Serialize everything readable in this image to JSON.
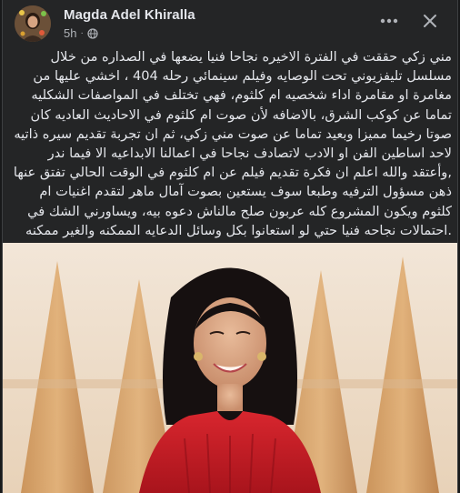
{
  "post": {
    "author_name": "Magda Adel Khiralla",
    "timestamp": "5h",
    "privacy_icon": "globe-icon",
    "more_icon": "more-horizontal-icon",
    "close_icon": "close-icon",
    "text_lines": [
      "مني زكي حققت في الفترة الاخيره نجاحا فنيا يضعها في الصداره من خلال",
      "مسلسل تليفزيوني تحت الوصايه وفيلم سينمائي رحله 404 ، اخشي عليها من",
      "مغامرة او مقامرة اداء شخصيه ام كلثوم، فهي تختلف  في المواصفات الشكليه",
      "تماما عن كوكب الشرق، بالاضافه لأن صوت ام كلثوم في الاحاديث العاديه كان",
      "صوتا رخيما مميزا وبعيد تماما عن صوت مني زكي، ثم ان تجربة تقديم سيره ذاتيه",
      "لاحد اساطين الفن او الادب لاتصادف نجاحا في اعمالنا  الابداعيه الا فيما ندر",
      ",وأعتقد والله اعلم ان فكرة تقديم فيلم عن ام كلثوم في الوقت الحالي تفتق عنها",
      "ذهن مسؤول الترفيه وطبعا سوف يستعين بصوت آمال ماهر لتقدم اغنيات ام",
      "كلثوم ويكون المشروع كله عربون صلح  مالناش دعوه بيه، ويساورني الشك في",
      ".احتمالات نجاحه فنيا حتي لو استعانوا بكل وسائل الدعايه الممكنه والغير ممكنه"
    ]
  },
  "colors": {
    "card_bg": "#242526",
    "text_primary": "#e4e6eb",
    "text_secondary": "#b0b3b8",
    "dress_red": "#c8202a"
  }
}
